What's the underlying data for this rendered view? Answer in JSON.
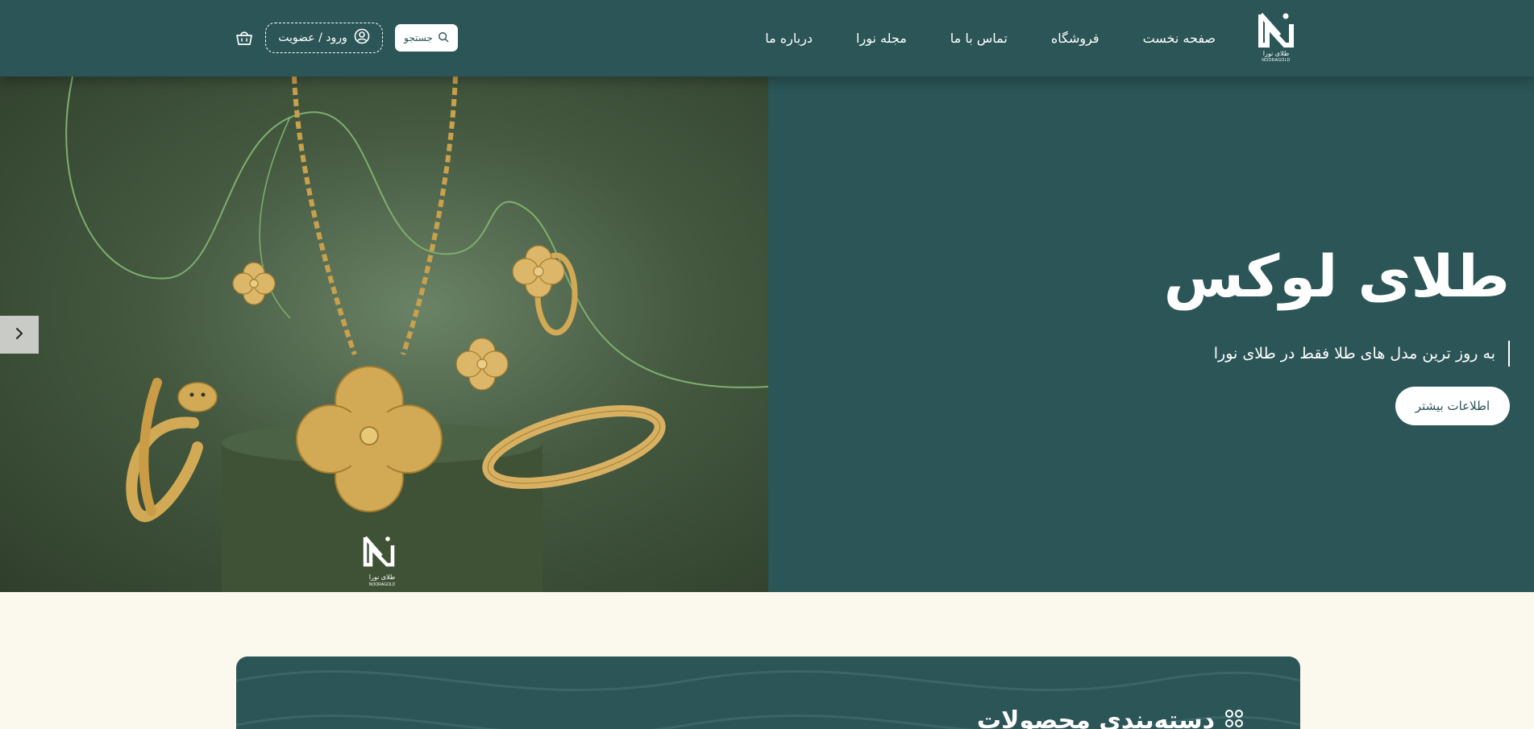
{
  "brand": {
    "name_fa": "طلای نورا",
    "name_en": "NOORAGOLD"
  },
  "nav": {
    "items": [
      "صفحه نخست",
      "فروشگاه",
      "تماس با ما",
      "مجله نورا",
      "درباره ما"
    ]
  },
  "header": {
    "search_label": "جستجو",
    "login_label": "ورود / عضویت"
  },
  "hero": {
    "title": "طلای لوکس",
    "subtitle": "به روز ترین مدل های طلا فقط در طلای نورا",
    "button_label": "اطلاعات بیشتر",
    "image_logo_fa": "طلای نورا",
    "image_logo_en": "NOORAGOLD"
  },
  "categories": {
    "title": "دسته‌بندی محصولات"
  },
  "icons": {
    "logo": "nooragold-logo-icon",
    "search": "search-icon",
    "user": "user-circle-icon",
    "cart": "shopping-basket-icon",
    "arrow": "chevron-right-icon",
    "grid": "grid-dots-icon"
  },
  "colors": {
    "primary": "#2b5557",
    "background": "#fbf8ee",
    "gold": "#d2aa55",
    "surface": "#ffffff"
  }
}
